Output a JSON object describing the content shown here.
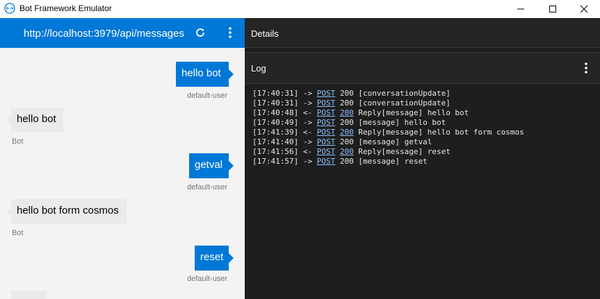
{
  "window": {
    "title": "Bot Framework Emulator",
    "minimize_icon": "minimize-icon",
    "maximize_icon": "maximize-icon",
    "close_icon": "close-icon"
  },
  "chat": {
    "endpoint_url": "http://localhost:3979/api/messages",
    "refresh_icon": "refresh-icon",
    "menu_icon": "more-vertical-icon",
    "messages": [
      {
        "from": "user",
        "text": "hello bot",
        "sender": "default-user"
      },
      {
        "from": "bot",
        "text": "hello bot",
        "sender": "Bot"
      },
      {
        "from": "user",
        "text": "getval",
        "sender": "default-user"
      },
      {
        "from": "bot",
        "text": "hello bot form cosmos",
        "sender": "Bot"
      },
      {
        "from": "user",
        "text": "reset",
        "sender": "default-user"
      }
    ]
  },
  "details": {
    "title": "Details"
  },
  "log": {
    "title": "Log",
    "menu_icon": "more-vertical-icon",
    "lines": [
      {
        "time": "[17:40:31]",
        "arrow": "->",
        "method": "POST",
        "status": "200",
        "status_link": false,
        "text": "[conversationUpdate]"
      },
      {
        "time": "[17:40:31]",
        "arrow": "->",
        "method": "POST",
        "status": "200",
        "status_link": false,
        "text": "[conversationUpdate]"
      },
      {
        "time": "[17:40:48]",
        "arrow": "<-",
        "method": "POST",
        "status": "200",
        "status_link": true,
        "text": "Reply[message] hello bot"
      },
      {
        "time": "[17:40:49]",
        "arrow": "->",
        "method": "POST",
        "status": "200",
        "status_link": false,
        "text": "[message] hello bot"
      },
      {
        "time": "[17:41:39]",
        "arrow": "<-",
        "method": "POST",
        "status": "200",
        "status_link": true,
        "text": "Reply[message] hello bot form cosmos"
      },
      {
        "time": "[17:41:40]",
        "arrow": "->",
        "method": "POST",
        "status": "200",
        "status_link": false,
        "text": "[message] getval"
      },
      {
        "time": "[17:41:56]",
        "arrow": "<-",
        "method": "POST",
        "status": "200",
        "status_link": true,
        "text": "Reply[message] reset"
      },
      {
        "time": "[17:41:57]",
        "arrow": "->",
        "method": "POST",
        "status": "200",
        "status_link": false,
        "text": "[message] reset"
      }
    ]
  },
  "colors": {
    "accent": "#0078d7",
    "chat_bg": "#f3f3f3",
    "bot_bubble": "#eaeaea",
    "log_bg": "#1e1e1e",
    "panel_header": "#252526",
    "link": "#8ac0ff"
  }
}
